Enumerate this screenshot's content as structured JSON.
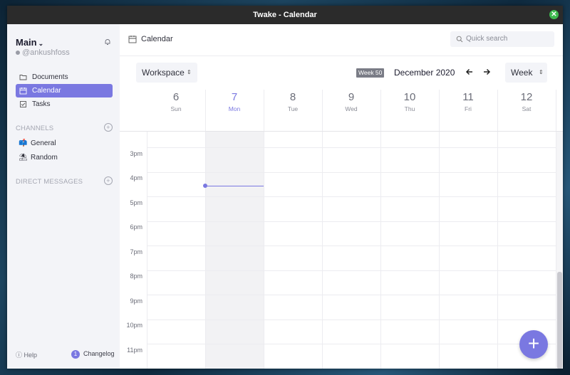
{
  "window": {
    "title": "Twake - Calendar",
    "close_icon": "close-icon"
  },
  "sidebar": {
    "workspace": "Main",
    "user": "@ankushfoss",
    "nav": [
      {
        "label": "Documents",
        "icon": "folder-icon"
      },
      {
        "label": "Calendar",
        "icon": "calendar-icon",
        "active": true
      },
      {
        "label": "Tasks",
        "icon": "checkbox-icon"
      }
    ],
    "channels_header": "CHANNELS",
    "channels": [
      {
        "label": "General",
        "emoji": "📫"
      },
      {
        "label": "Random",
        "emoji": "⛱"
      }
    ],
    "dm_header": "DIRECT MESSAGES",
    "help": "Help",
    "changelog": {
      "label": "Changelog",
      "count": "1"
    }
  },
  "main": {
    "title": "Calendar",
    "search_placeholder": "Quick search",
    "workspace_select": "Workspace",
    "week_badge": "Week 50",
    "month": "December 2020",
    "view_select": "Week",
    "days": [
      {
        "num": "6",
        "name": "Sun"
      },
      {
        "num": "7",
        "name": "Mon",
        "today": true
      },
      {
        "num": "8",
        "name": "Tue"
      },
      {
        "num": "9",
        "name": "Wed"
      },
      {
        "num": "10",
        "name": "Thu"
      },
      {
        "num": "11",
        "name": "Fri"
      },
      {
        "num": "12",
        "name": "Sat"
      }
    ],
    "hours": [
      "3pm",
      "4pm",
      "5pm",
      "6pm",
      "7pm",
      "8pm",
      "9pm",
      "10pm",
      "11pm"
    ],
    "add_label": "+"
  },
  "colors": {
    "accent": "#7a78e1",
    "titlebar": "#2b2b2b",
    "sidebar": "#f3f4f8"
  }
}
